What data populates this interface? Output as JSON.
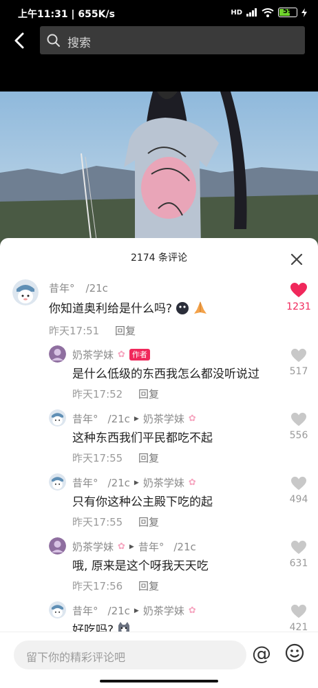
{
  "status_bar": {
    "time_speed": "上午11:31 | 655K/s",
    "signal": "HD",
    "battery": "59"
  },
  "search": {
    "placeholder": "搜索"
  },
  "comments_panel": {
    "title": "2174 条评论",
    "comments": [
      {
        "user": "昔年°",
        "user_suffix": "/21c",
        "text": "你知道奥利给是什么吗?",
        "time": "昨天17:51",
        "reply": "回复",
        "likes": "1231",
        "liked": true
      },
      {
        "user": "奶茶学妹",
        "badge": "作者",
        "text": "是什么低级的东西我怎么都没听说过",
        "time": "昨天17:52",
        "reply": "回复",
        "likes": "517"
      },
      {
        "user": "昔年°",
        "user_suffix": "/21c",
        "reply_to": "奶茶学妹",
        "text": "这种东西我们平民都吃不起",
        "time": "昨天17:55",
        "reply": "回复",
        "likes": "556"
      },
      {
        "user": "昔年°",
        "user_suffix": "/21c",
        "reply_to": "奶茶学妹",
        "text": "只有你这种公主殿下吃的起",
        "time": "昨天17:55",
        "reply": "回复",
        "likes": "494"
      },
      {
        "user": "奶茶学妹",
        "reply_to": "昔年°",
        "reply_to_suffix": "/21c",
        "text": "哦, 原来是这个呀我天天吃",
        "time": "昨天17:56",
        "reply": "回复",
        "likes": "631"
      },
      {
        "user": "昔年°",
        "user_suffix": "/21c",
        "reply_to": "奶茶学妹",
        "text": "好吃吗?",
        "likes": "421"
      }
    ]
  },
  "input": {
    "placeholder": "留下你的精彩评论吧",
    "at": "@"
  },
  "colors": {
    "accent": "#f0285b",
    "muted": "#9a9a9a"
  }
}
